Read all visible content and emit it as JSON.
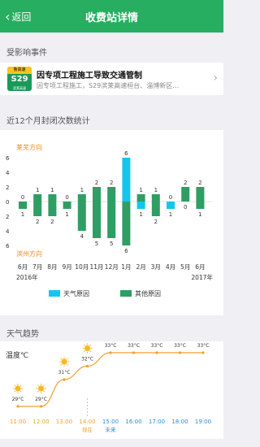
{
  "navbar": {
    "back_label": "返回",
    "title": "收费站详情"
  },
  "sections": {
    "affected_events": "受影响事件",
    "closure_stats": "近12个月封闭次数统计",
    "weather_trend": "天气趋势"
  },
  "event": {
    "badge_top": "鲁高速",
    "badge_code": "S29",
    "badge_name": "滨莱高速",
    "title": "因专项工程施工导致交通管制",
    "desc": "因专项工程施工，S29滨莱高速桓台、淄博新区…"
  },
  "chart_data": {
    "type": "bar",
    "categories": [
      "6月",
      "7月",
      "8月",
      "9月",
      "10月",
      "11月",
      "12月",
      "1月",
      "2月",
      "3月",
      "4月",
      "5月",
      "6月"
    ],
    "year_labels": {
      "first": "2016年",
      "last": "2017年"
    },
    "upper_label": "莱芜方向",
    "lower_label": "滨州方向",
    "y_ticks": [
      "6",
      "4",
      "2",
      "0",
      "2",
      "4",
      "6"
    ],
    "ylim": [
      -6,
      6
    ],
    "series": [
      {
        "name": "天气原因",
        "color": "#14c6ef",
        "upper": [
          0,
          0,
          0,
          0,
          0,
          0,
          0,
          6,
          0,
          0,
          0,
          0,
          0
        ],
        "lower": [
          0,
          0,
          0,
          0,
          0,
          0,
          0,
          0,
          1,
          0,
          1,
          0,
          0
        ]
      },
      {
        "name": "其他原因",
        "color": "#2e9e64",
        "upper": [
          0,
          1,
          1,
          0,
          1,
          2,
          2,
          0,
          1,
          1,
          0,
          2,
          2
        ],
        "lower": [
          1,
          2,
          2,
          1,
          4,
          5,
          5,
          6,
          0,
          2,
          0,
          0,
          1
        ]
      }
    ],
    "upper_totals": [
      0,
      1,
      1,
      0,
      1,
      2,
      2,
      6,
      1,
      1,
      0,
      2,
      2
    ],
    "lower_totals": [
      1,
      2,
      2,
      1,
      4,
      5,
      5,
      6,
      1,
      2,
      1,
      0,
      1
    ]
  },
  "weather": {
    "y_label": "温度℃",
    "times": [
      "11:00",
      "12:00",
      "13:00",
      "14:00",
      "15:00",
      "16:00",
      "17:00",
      "18:00",
      "19:00"
    ],
    "sub_labels": [
      "",
      "",
      "",
      "现在",
      "未来",
      "",
      "",
      "",
      ""
    ],
    "temps": [
      "29°C",
      "29°C",
      "31°C",
      "32°C",
      "33°C",
      "33°C",
      "33°C",
      "33°C",
      "33°C"
    ],
    "temp_values": [
      29,
      29,
      31,
      32,
      33,
      33,
      33,
      33,
      33
    ],
    "past_color": "#f0a030",
    "future_color": "#2a8ed6",
    "icon": "sun-icon"
  }
}
